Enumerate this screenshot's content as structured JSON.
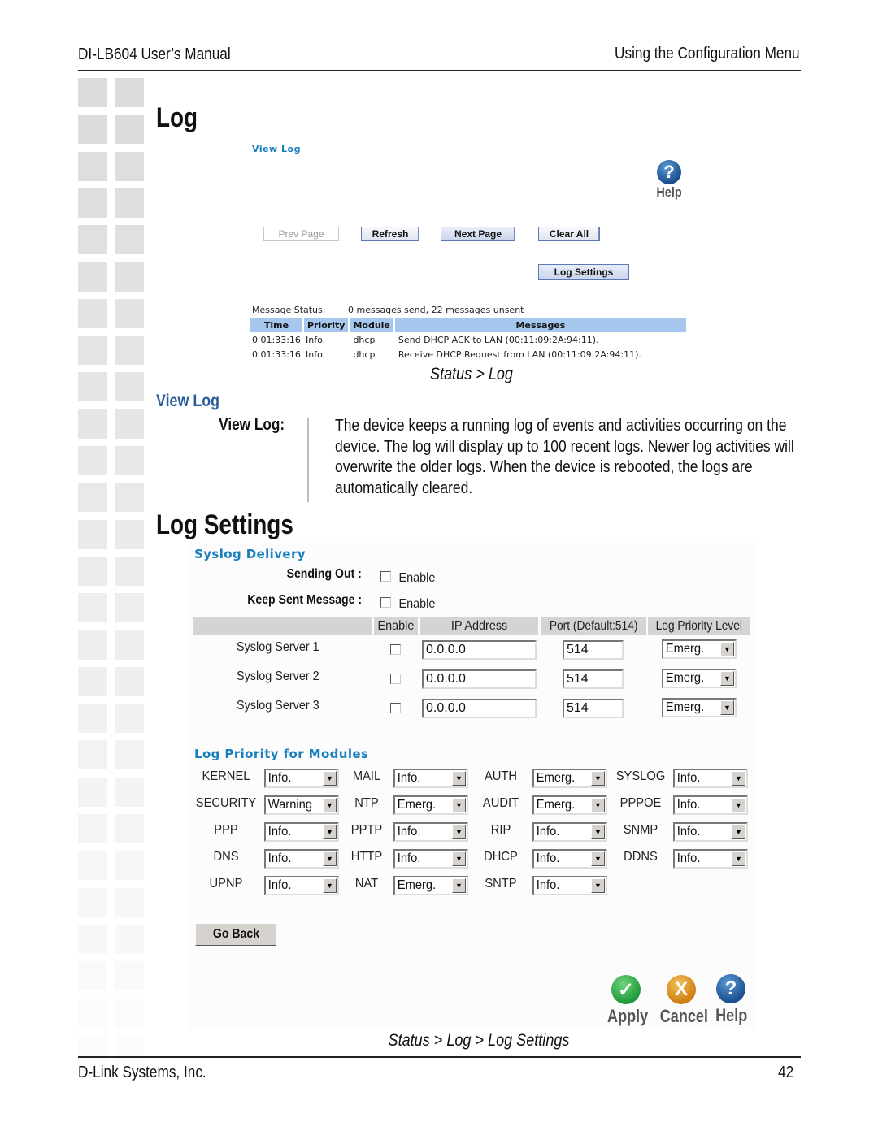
{
  "header": {
    "manual_title": "DI-LB604 User’s Manual",
    "chapter_title": "Using the Configuration Menu"
  },
  "footer": {
    "company": "D-Link Systems, Inc.",
    "page_number": "42"
  },
  "log_section": {
    "title": "Log",
    "screenshot": {
      "view_log_link": "View Log",
      "help_label": "Help",
      "help_glyph": "?",
      "buttons": {
        "prev_page": "Prev Page",
        "refresh": "Refresh",
        "next_page": "Next Page",
        "clear_all": "Clear All",
        "log_settings": "Log Settings"
      },
      "message_status_label": "Message Status:",
      "message_status_value": "0 messages send, 22 messages unsent",
      "table": {
        "columns": [
          "Time",
          "Priority",
          "Module",
          "Messages"
        ],
        "rows": [
          [
            "0 01:33:16",
            "Info.",
            "dhcp",
            "Send DHCP ACK to LAN (00:11:09:2A:94:11)."
          ],
          [
            "0 01:33:16",
            "Info.",
            "dhcp",
            "Receive DHCP Request from LAN (00:11:09:2A:94:11)."
          ]
        ]
      },
      "header_color": "#a6c8ee"
    },
    "caption": "Status > Log"
  },
  "view_log_section": {
    "title": "View Log",
    "term": "View Log:",
    "description": "The device keeps a running log of events and activities occurring on the device. The log will display up to 100 recent logs. Newer log activities will overwrite the older logs. When the device is rebooted, the logs are automatically cleared."
  },
  "log_settings_section": {
    "title": "Log Settings",
    "screenshot": {
      "syslog_delivery_heading": "Syslog Delivery",
      "sending_out_label": "Sending Out :",
      "sending_out_option": "Enable",
      "sending_out_checked": false,
      "keep_sent_label": "Keep Sent Message :",
      "keep_sent_option": "Enable",
      "keep_sent_checked": false,
      "server_columns": [
        "Enable",
        "IP Address",
        "Port (Default:514)",
        "Log Priority Level"
      ],
      "servers": [
        {
          "name": "Syslog Server 1",
          "enabled": false,
          "ip": "0.0.0.0",
          "port": "514",
          "priority": "Emerg."
        },
        {
          "name": "Syslog Server 2",
          "enabled": false,
          "ip": "0.0.0.0",
          "port": "514",
          "priority": "Emerg."
        },
        {
          "name": "Syslog Server 3",
          "enabled": false,
          "ip": "0.0.0.0",
          "port": "514",
          "priority": "Emerg."
        }
      ],
      "modules_heading": "Log Priority for Modules",
      "modules": [
        {
          "name": "KERNEL",
          "value": "Info."
        },
        {
          "name": "MAIL",
          "value": "Info."
        },
        {
          "name": "AUTH",
          "value": "Emerg."
        },
        {
          "name": "SYSLOG",
          "value": "Info."
        },
        {
          "name": "SECURITY",
          "value": "Warning"
        },
        {
          "name": "NTP",
          "value": "Emerg."
        },
        {
          "name": "AUDIT",
          "value": "Emerg."
        },
        {
          "name": "PPPOE",
          "value": "Info."
        },
        {
          "name": "PPP",
          "value": "Info."
        },
        {
          "name": "PPTP",
          "value": "Info."
        },
        {
          "name": "RIP",
          "value": "Info."
        },
        {
          "name": "SNMP",
          "value": "Info."
        },
        {
          "name": "DNS",
          "value": "Info."
        },
        {
          "name": "HTTP",
          "value": "Info."
        },
        {
          "name": "DHCP",
          "value": "Info."
        },
        {
          "name": "DDNS",
          "value": "Info."
        },
        {
          "name": "UPNP",
          "value": "Info."
        },
        {
          "name": "NAT",
          "value": "Emerg."
        },
        {
          "name": "SNTP",
          "value": "Info."
        }
      ],
      "go_back_label": "Go Back",
      "actions": {
        "apply": "Apply",
        "apply_glyph": "✓",
        "cancel": "Cancel",
        "cancel_glyph": "X",
        "help": "Help",
        "help_glyph": "?"
      },
      "heading_color": "#1a7fbf"
    },
    "caption": "Status > Log > Log Settings"
  }
}
